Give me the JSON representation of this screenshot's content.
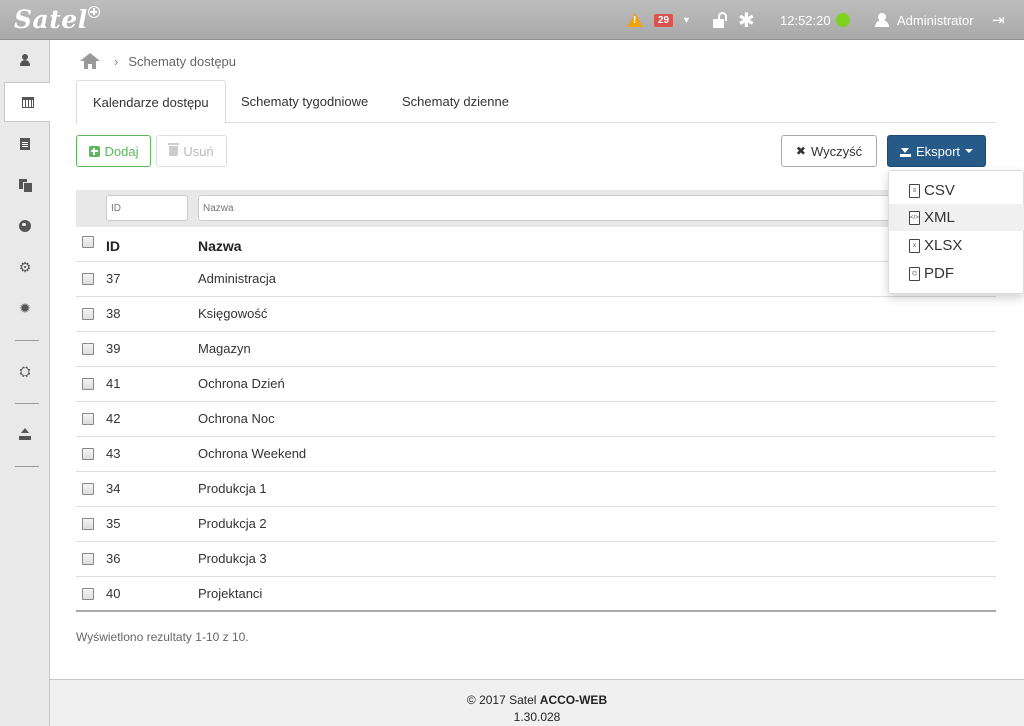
{
  "topbar": {
    "logo": "Satel",
    "alarm_count": "29",
    "time": "12:52:20",
    "user_name": "Administrator",
    "status_color": "#7ed321"
  },
  "sidebar": {
    "items": [
      {
        "icon": "person-icon"
      },
      {
        "icon": "calendar-icon",
        "active": true
      },
      {
        "icon": "document-icon"
      },
      {
        "icon": "documents-icon"
      },
      {
        "icon": "globe-icon"
      },
      {
        "icon": "gears-icon"
      },
      {
        "icon": "gear-icon"
      },
      {
        "icon": "network-icon"
      },
      {
        "icon": "upload-icon"
      }
    ]
  },
  "breadcrumb": {
    "current": "Schematy dostępu"
  },
  "tabs": [
    {
      "label": "Kalendarze dostępu",
      "active": true
    },
    {
      "label": "Schematy tygodniowe"
    },
    {
      "label": "Schematy dzienne"
    }
  ],
  "toolbar": {
    "add_label": "Dodaj",
    "delete_label": "Usuń",
    "clear_label": "Wyczyść",
    "export_label": "Eksport"
  },
  "filters": {
    "id_placeholder": "ID",
    "name_placeholder": "Nazwa"
  },
  "table": {
    "columns": [
      "ID",
      "Nazwa"
    ],
    "rows": [
      {
        "id": "37",
        "name": "Administracja"
      },
      {
        "id": "38",
        "name": "Księgowość"
      },
      {
        "id": "39",
        "name": "Magazyn"
      },
      {
        "id": "41",
        "name": "Ochrona Dzień"
      },
      {
        "id": "42",
        "name": "Ochrona Noc"
      },
      {
        "id": "43",
        "name": "Ochrona Weekend"
      },
      {
        "id": "34",
        "name": "Produkcja 1"
      },
      {
        "id": "35",
        "name": "Produkcja 2"
      },
      {
        "id": "36",
        "name": "Produkcja 3"
      },
      {
        "id": "40",
        "name": "Projektanci"
      }
    ],
    "summary": "Wyświetlono rezultaty 1-10 z 10."
  },
  "export_menu": {
    "items": [
      {
        "label": "CSV",
        "icon": "csv-file-icon"
      },
      {
        "label": "XML",
        "icon": "xml-file-icon",
        "hover": true
      },
      {
        "label": "XLSX",
        "icon": "xlsx-file-icon"
      },
      {
        "label": "PDF",
        "icon": "pdf-file-icon"
      }
    ]
  },
  "footer": {
    "copyright_prefix": "© 2017 Satel ",
    "product": "ACCO-WEB",
    "version": "1.30.028"
  },
  "colors": {
    "topbar": "#b3b3b3",
    "accent_blue": "#265a88",
    "add_green": "#5cb85c",
    "alarm_red": "#d9534f",
    "warning_orange": "#f0a30a"
  }
}
